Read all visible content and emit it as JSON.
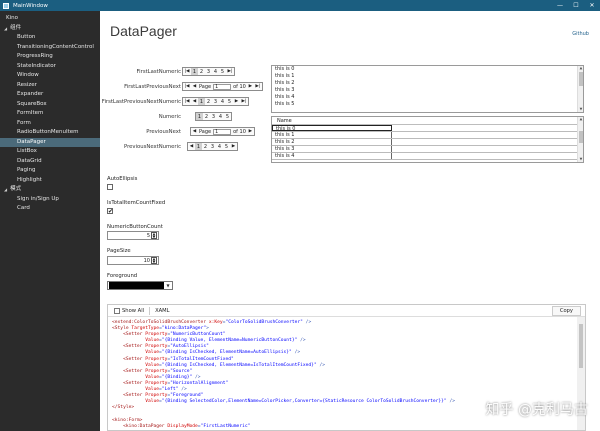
{
  "window": {
    "title": "MainWindow",
    "minimize": "—",
    "maximize": "☐",
    "close": "✕"
  },
  "sidebar": {
    "root": "Kino",
    "groups": [
      {
        "label": "组件",
        "items": [
          "Button",
          "TransitioningContentControl",
          "ProgressRing",
          "StateIndicator",
          "Window",
          "Resizer",
          "Expander",
          "SquareBox",
          "FormItem",
          "Form",
          "RadioButtonMenuItem",
          "DataPager",
          "ListBox",
          "DataGrid",
          "Paging",
          "Highlight"
        ]
      },
      {
        "label": "模式",
        "items": [
          "Sign in/Sign Up",
          "Card"
        ]
      }
    ],
    "active": "DataPager"
  },
  "main": {
    "title": "DataPager",
    "github": "Github"
  },
  "pagers": [
    {
      "label": "FirstLastNumeric"
    },
    {
      "label": "FirstLastPreviousNext",
      "page_text": "Page",
      "page_value": "1",
      "of_text": "of 10"
    },
    {
      "label": "FirstLastPreviousNextNumeric"
    },
    {
      "label": "Numeric"
    },
    {
      "label": "PreviousNext",
      "page_text": "Page",
      "page_value": "1",
      "of_text": "of 10"
    },
    {
      "label": "PreviousNextNumeric"
    }
  ],
  "pager_numbers": [
    "1",
    "2",
    "3",
    "4",
    "5"
  ],
  "listbox": {
    "items": [
      "this is 0",
      "this is 1",
      "this is 2",
      "this is 3",
      "this is 4",
      "this is 5"
    ]
  },
  "datagrid": {
    "header": "Name",
    "rows": [
      "this is 0",
      "this is 1",
      "this is 2",
      "this is 3",
      "this is 4"
    ]
  },
  "settings": {
    "auto_ellipsis": {
      "label": "AutoEllipsis",
      "checked": false
    },
    "total_fixed": {
      "label": "IsTotalItemCountFixed",
      "checked": true,
      "mark": "✔"
    },
    "numeric_count": {
      "label": "NumericButtonCount",
      "value": "5"
    },
    "page_size": {
      "label": "PageSize",
      "value": "10"
    },
    "foreground": {
      "label": "Foreground",
      "color": "#000000"
    }
  },
  "code_panel": {
    "show_all": "Show All",
    "tab": "XAML",
    "copy": "Copy"
  },
  "watermark": "知乎 @克利马古"
}
